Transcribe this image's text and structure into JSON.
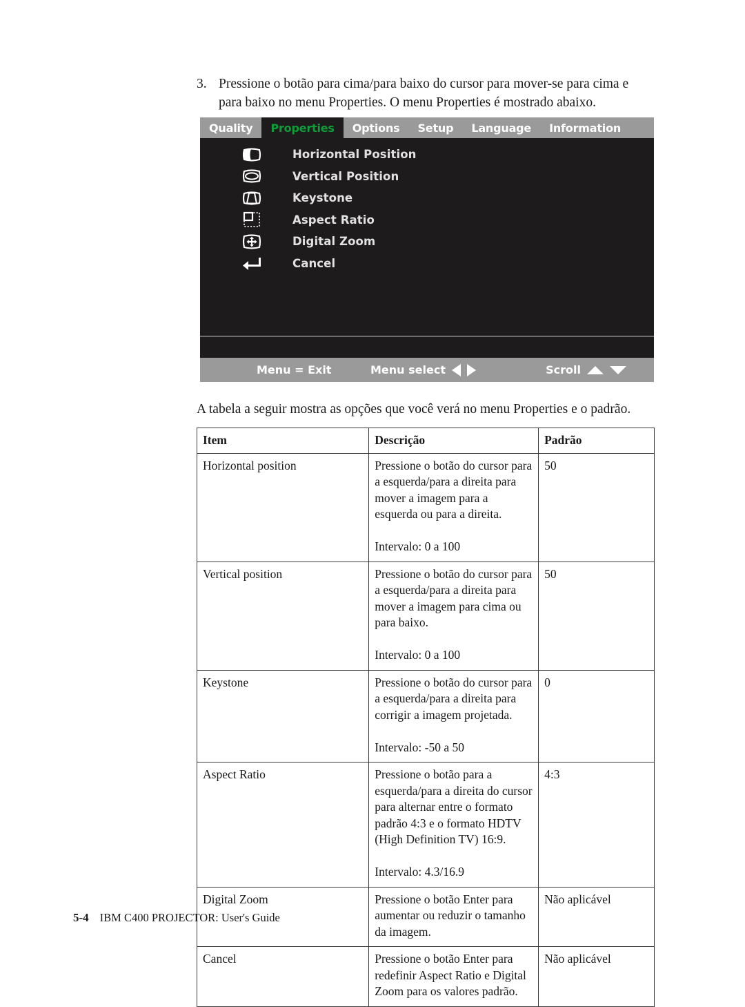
{
  "step": {
    "number": "3.",
    "text": "Pressione o botão para cima/para baixo do cursor para mover-se para cima e para baixo no menu Properties. O menu Properties é mostrado abaixo."
  },
  "osd": {
    "colors": {
      "bar": "#9a9a9a",
      "panel": "#1d1b1b",
      "active_text": "#0f9d3a",
      "label": "#e2e2e2"
    },
    "tabs": [
      {
        "label": "Quality",
        "active": false
      },
      {
        "label": "Properties",
        "active": true
      },
      {
        "label": "Options",
        "active": false
      },
      {
        "label": "Setup",
        "active": false
      },
      {
        "label": "Language",
        "active": false
      },
      {
        "label": "Information",
        "active": false
      }
    ],
    "items": [
      {
        "label": "Horizontal Position",
        "icon": "horizontal-position-icon"
      },
      {
        "label": "Vertical Position",
        "icon": "vertical-position-icon"
      },
      {
        "label": "Keystone",
        "icon": "keystone-icon"
      },
      {
        "label": "Aspect Ratio",
        "icon": "aspect-ratio-icon"
      },
      {
        "label": "Digital Zoom",
        "icon": "digital-zoom-icon"
      },
      {
        "label": "Cancel",
        "icon": "enter-return-icon"
      }
    ],
    "footer": {
      "exit": "Menu = Exit",
      "select": "Menu select",
      "scroll": "Scroll"
    }
  },
  "intro": "A tabela a seguir mostra as opções que você verá no menu Properties e o padrão.",
  "table": {
    "headers": [
      "Item",
      "Descrição",
      "Padrão"
    ],
    "rows": [
      {
        "item": "Horizontal position",
        "desc": "Pressione o botão do cursor para a esquerda/para a direita para mover a imagem para a esquerda ou para a direita.",
        "range": "Intervalo: 0 a 100",
        "default": "50"
      },
      {
        "item": "Vertical position",
        "desc": "Pressione o botão do cursor para a esquerda/para a direita para mover a imagem para cima ou para baixo.",
        "range": "Intervalo: 0 a 100",
        "default": "50"
      },
      {
        "item": "Keystone",
        "desc": "Pressione o botão do cursor para a esquerda/para a direita para corrigir a imagem projetada.",
        "range": "Intervalo: -50 a 50",
        "default": "0"
      },
      {
        "item": "Aspect Ratio",
        "desc": "Pressione o botão para a esquerda/para a direita do cursor para alternar entre o formato padrão 4:3 e o formato HDTV (High Definition TV) 16:9.",
        "range": "Intervalo: 4.3/16.9",
        "default": "4:3"
      },
      {
        "item": "Digital Zoom",
        "desc": "Pressione o botão Enter para aumentar ou reduzir o tamanho da imagem.",
        "range": "",
        "default": "Não aplicável"
      },
      {
        "item": "Cancel",
        "desc": "Pressione o botão Enter para redefinir Aspect Ratio e Digital Zoom para os valores padrão.",
        "range": "",
        "default": "Não aplicável"
      }
    ]
  },
  "page_footer": {
    "page": "5-4",
    "title": "IBM C400 PROJECTOR: User's Guide"
  }
}
